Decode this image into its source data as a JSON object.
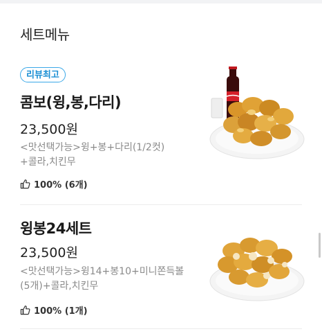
{
  "section": {
    "title": "세트메뉴"
  },
  "items": [
    {
      "badge": "리뷰최고",
      "name": "콤보(윙,봉,다리)",
      "price": "23,500원",
      "desc_line1": "<맛선택가능>윙+봉+다리(1/2컷)",
      "desc_line2": "+콜라,치킨무",
      "likes": "100% (6개)",
      "image": "fried-chicken-with-cola"
    },
    {
      "name": "윙봉24세트",
      "price": "23,500원",
      "desc_line1": "<맛선택가능>윙14+봉10+미니쫀득볼",
      "desc_line2": "(5개)+콜라,치킨무",
      "likes": "100% (1개)",
      "image": "fried-chicken-wings"
    }
  ],
  "icons": {
    "like": "thumbs-up-icon"
  },
  "colors": {
    "badge": "#1b8fd4",
    "desc": "#8a8a8a"
  }
}
